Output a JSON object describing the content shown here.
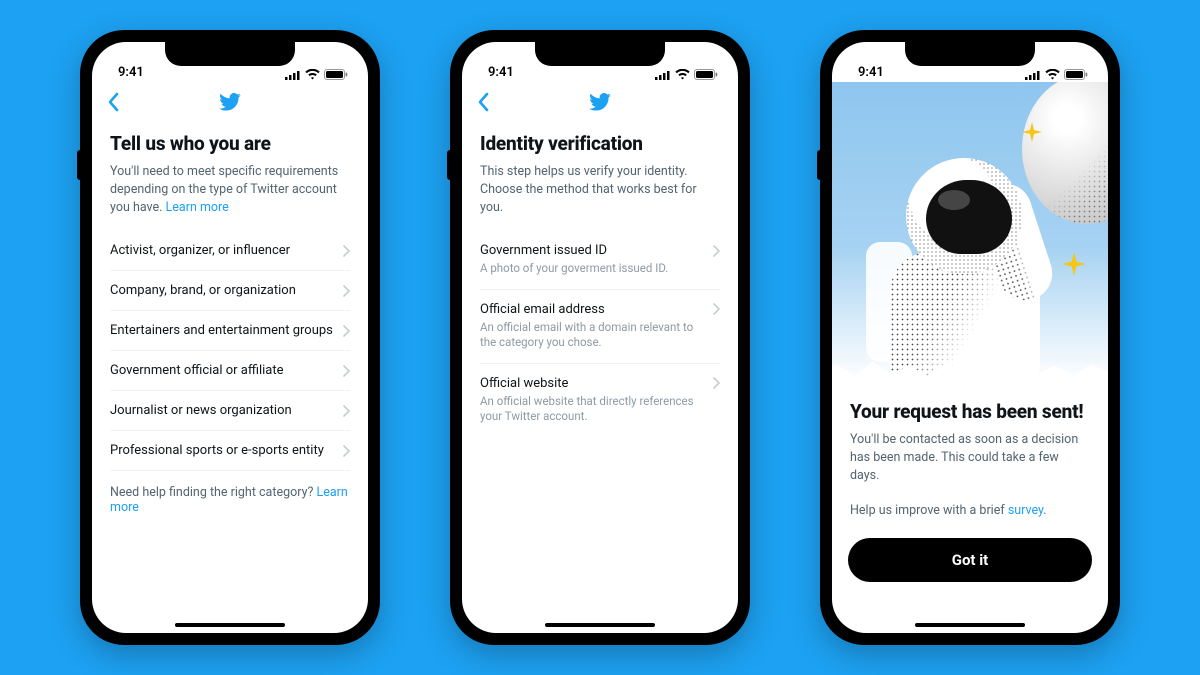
{
  "status": {
    "time": "9:41"
  },
  "phone1": {
    "title": "Tell us who you are",
    "lead_before": "You'll need to meet specific requirements depending on the type of Twitter account you have. ",
    "lead_link": "Learn more",
    "categories": [
      "Activist, organizer, or influencer",
      "Company, brand, or organization",
      "Entertainers and entertainment groups",
      "Government official or affiliate",
      "Journalist or news organization",
      "Professional sports or e-sports entity"
    ],
    "helper_before": "Need help finding the right category? ",
    "helper_link": "Learn more"
  },
  "phone2": {
    "title": "Identity verification",
    "lead": "This step helps us verify your identity. Choose the method that works best for you.",
    "options": [
      {
        "label": "Government issued ID",
        "sub": "A photo of your goverment issued ID."
      },
      {
        "label": "Official email address",
        "sub": "An official email with a domain relevant to the category you chose."
      },
      {
        "label": "Official website",
        "sub": "An official website that directly references your Twitter account."
      }
    ]
  },
  "phone3": {
    "title": "Your request has been sent!",
    "lead": "You'll be contacted as soon as a decision has been made. This could take a few days.",
    "help_before": "Help us improve with a brief ",
    "help_link": "survey",
    "help_after": ".",
    "cta": "Got it"
  }
}
